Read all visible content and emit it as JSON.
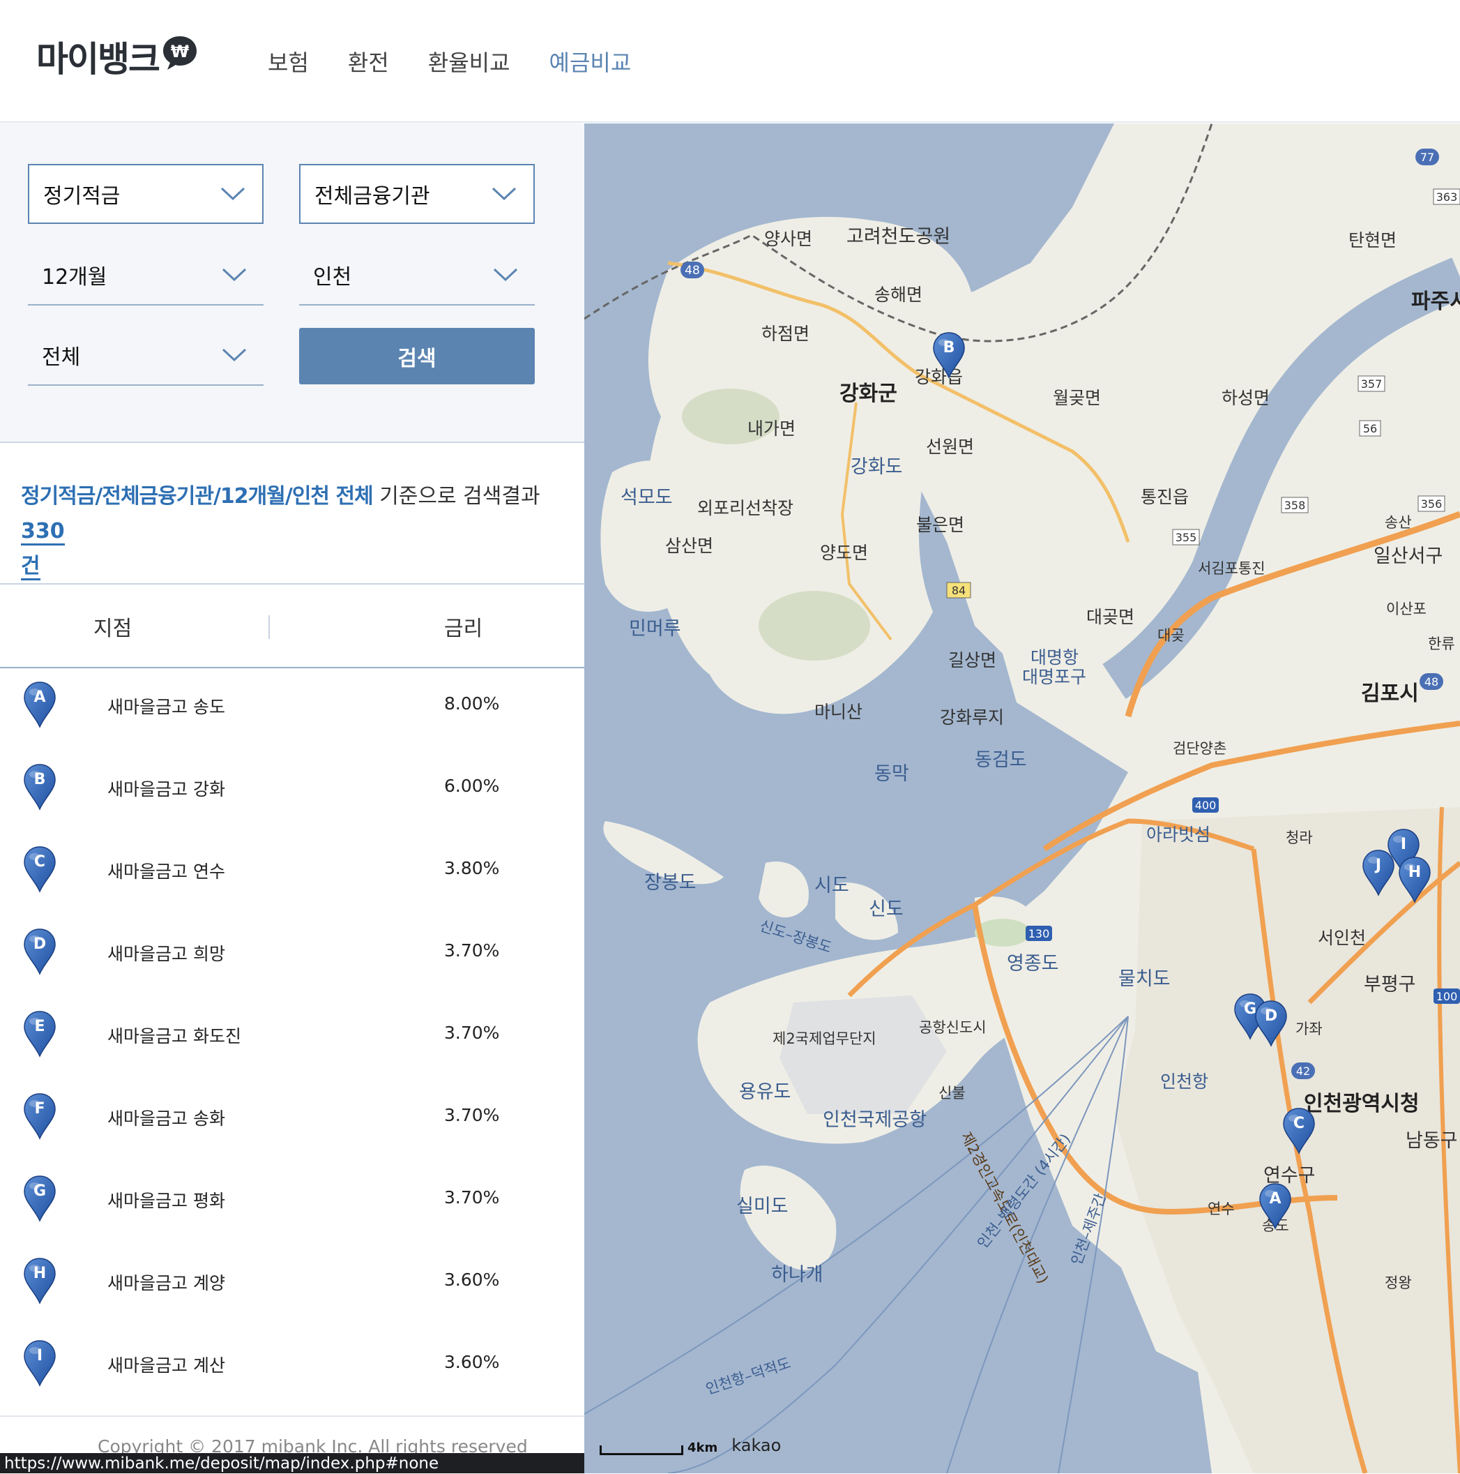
{
  "header": {
    "logo_text": "마이뱅크",
    "logo_symbol": "₩",
    "nav": [
      {
        "label": "보험",
        "active": false
      },
      {
        "label": "환전",
        "active": false
      },
      {
        "label": "환율비교",
        "active": false
      },
      {
        "label": "예금비교",
        "active": true
      }
    ]
  },
  "filters": {
    "product": "정기적금",
    "institution": "전체금융기관",
    "period": "12개월",
    "region": "인천",
    "district": "전체",
    "search_label": "검색"
  },
  "summary": {
    "criteria": "정기적금/전체금융기관/12개월/인천 전체",
    "middle": " 기준으로 검색결과 ",
    "count": "330",
    "unit": "건"
  },
  "table": {
    "col_branch": "지점",
    "col_rate": "금리",
    "rows": [
      {
        "letter": "A",
        "name": "새마을금고 송도",
        "rate": "8.00%"
      },
      {
        "letter": "B",
        "name": "새마을금고 강화",
        "rate": "6.00%"
      },
      {
        "letter": "C",
        "name": "새마을금고 연수",
        "rate": "3.80%"
      },
      {
        "letter": "D",
        "name": "새마을금고 희망",
        "rate": "3.70%"
      },
      {
        "letter": "E",
        "name": "새마을금고 화도진",
        "rate": "3.70%"
      },
      {
        "letter": "F",
        "name": "새마을금고 송화",
        "rate": "3.70%"
      },
      {
        "letter": "G",
        "name": "새마을금고 평화",
        "rate": "3.70%"
      },
      {
        "letter": "H",
        "name": "새마을금고 계양",
        "rate": "3.60%"
      },
      {
        "letter": "I",
        "name": "새마을금고 계산",
        "rate": "3.60%"
      }
    ]
  },
  "footer": {
    "copyright": "Copyright © 2017 mibank Inc. All rights reserved",
    "status_url": "https://www.mibank.me/deposit/map/index.php#none"
  },
  "map": {
    "scale_label": "4km",
    "provider": "kakao",
    "labels": {
      "yangsa": "양사면",
      "goryeo": "고려천도공원",
      "songhae": "송해면",
      "hajeom": "하점면",
      "ganghwagun": "강화군",
      "ganghwaeup": "강화읍",
      "naega": "내가면",
      "wolgot": "월곶면",
      "haseong": "하성면",
      "seonwon": "선원면",
      "ganghwado": "강화도",
      "seokmodo": "석모도",
      "oepori": "외포리선착장",
      "samsan": "삼산면",
      "yangdo": "양도면",
      "bureun": "불은면",
      "tongjin": "통진읍",
      "seogimpo": "서김포통진",
      "daegot1": "대곶면",
      "daegot2": "대곶",
      "minmeoru": "민머루",
      "gilsang": "길상면",
      "daemyeong": "대명항",
      "daemyeongpo": "대명포구",
      "manisan": "마니산",
      "ganghwaruji": "강화루지",
      "dongmak": "동막",
      "donggeom": "동검도",
      "geomdan": "검단양촌",
      "ara": "아라빗섬",
      "cheongna": "청라",
      "gimpo": "김포시",
      "jangbong": "장봉도",
      "sido": "시도",
      "sindo": "신도",
      "sindojangbong": "신도–장봉도",
      "yeongjong": "영종도",
      "mulchi": "물치도",
      "seoin": "서인천",
      "bupyeong": "부평구",
      "gajwa": "가좌",
      "incheonhang": "인천항",
      "sihall": "인천광역시청",
      "yeonsu": "연수구",
      "yeonsuic": "연수",
      "songdo": "송도",
      "namdong": "남동구",
      "jeongwang": "정왕",
      "je2": "제2국제업무단지",
      "gonghang": "공항신도시",
      "sinbul": "신불",
      "yongyu": "용유도",
      "airport": "인천국제공항",
      "silmi": "실미도",
      "hanagae": "하나개",
      "bridge": "제2경인고속도로(인천대교)",
      "route1": "인천–백령도간 (4시간)",
      "route2": "인천–제주간",
      "route3": "인천항–덕적도",
      "paju": "파주시",
      "tanhyeon": "탄현면",
      "songsan": "송산",
      "ilsan": "일산서구",
      "isanpo": "이산포",
      "hanryu": "한류"
    },
    "route_numbers": [
      "48",
      "84",
      "355",
      "356",
      "357",
      "358",
      "363",
      "56",
      "77",
      "400",
      "130",
      "42",
      "100",
      "48"
    ],
    "pins": [
      "A",
      "B",
      "C",
      "D",
      "G",
      "H",
      "I",
      "J"
    ]
  }
}
